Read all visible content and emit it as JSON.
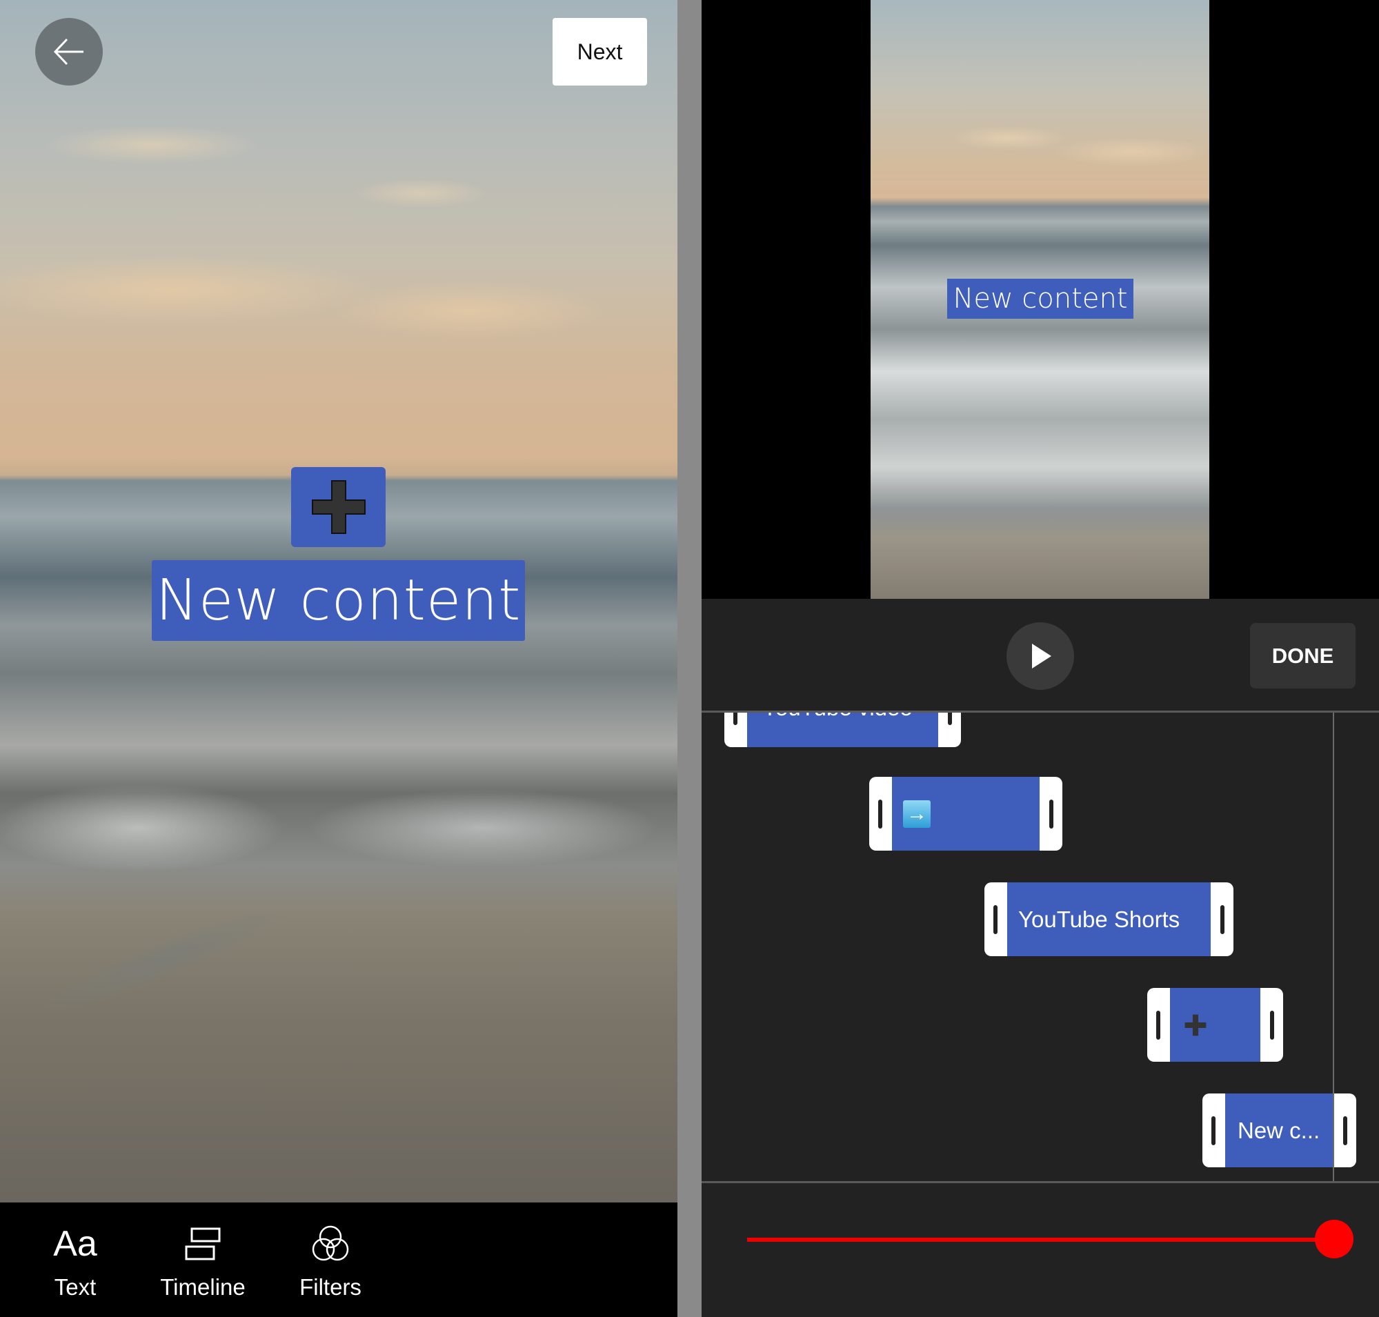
{
  "left_panel": {
    "back_button": {
      "icon": "arrow-left-icon"
    },
    "next_button": {
      "label": "Next"
    },
    "stickers": {
      "plus": {
        "icon": "heavy-plus-icon"
      },
      "text": {
        "label": "New content"
      }
    },
    "toolbar": [
      {
        "icon": "text-aa-icon",
        "glyph": "Aa",
        "label": "Text"
      },
      {
        "icon": "timeline-icon",
        "label": "Timeline"
      },
      {
        "icon": "filters-icon",
        "label": "Filters"
      }
    ]
  },
  "right_panel": {
    "preview": {
      "overlay_text": "New content"
    },
    "controls": {
      "play_icon": "play-icon",
      "done_label": "DONE"
    },
    "timeline": {
      "clips": [
        {
          "label": "YouTube video",
          "type": "text"
        },
        {
          "label": "",
          "type": "emoji",
          "emoji": "➡️"
        },
        {
          "label": "YouTube Shorts",
          "type": "text"
        },
        {
          "label": "",
          "type": "emoji",
          "emoji": "✚"
        },
        {
          "label": "New c...",
          "type": "text"
        }
      ]
    },
    "scrubber": {
      "progress_percent": 100
    }
  },
  "colors": {
    "sticker_blue": "#3f5dba",
    "scrubber_red": "#ff0000",
    "panel_dark": "#222222"
  }
}
